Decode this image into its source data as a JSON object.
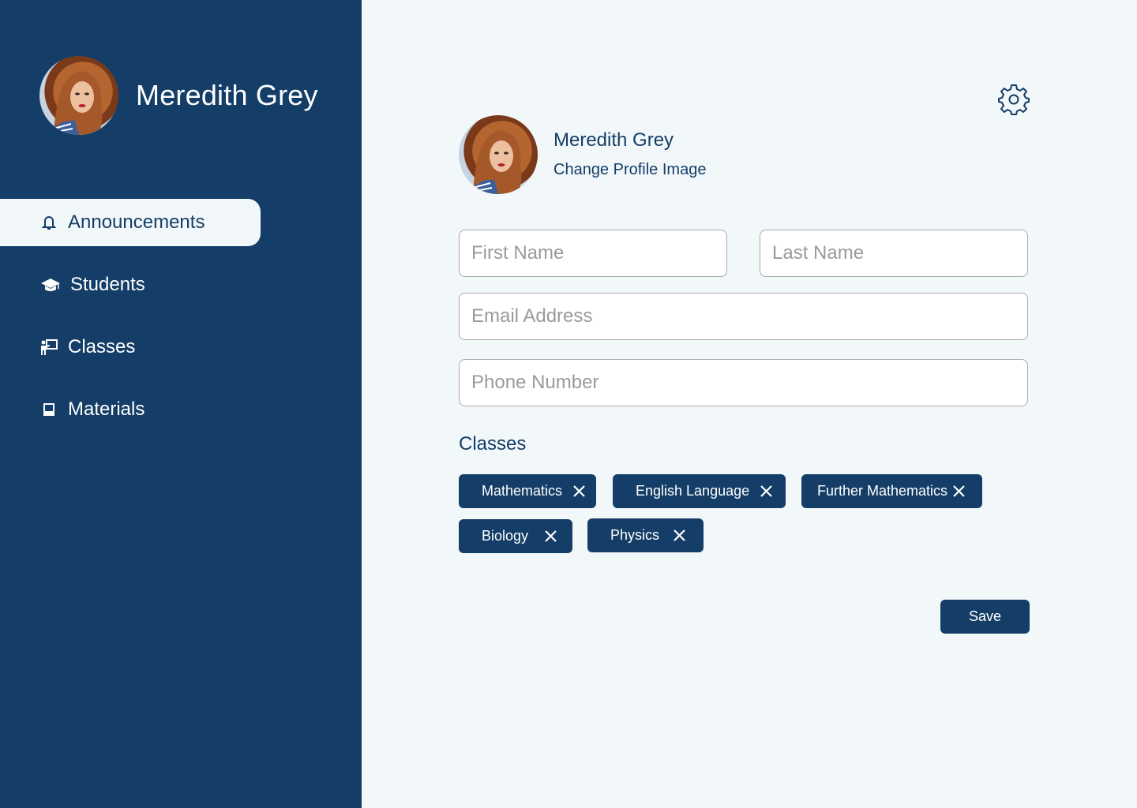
{
  "sidebar": {
    "user_name": "Meredith Grey",
    "nav": [
      {
        "label": "Announcements",
        "icon": "bell-icon",
        "active": true
      },
      {
        "label": "Students",
        "icon": "graduation-cap-icon",
        "active": false
      },
      {
        "label": "Classes",
        "icon": "teacher-board-icon",
        "active": false
      },
      {
        "label": "Materials",
        "icon": "book-icon",
        "active": false
      }
    ]
  },
  "profile": {
    "name": "Meredith Grey",
    "change_image_label": "Change Profile Image",
    "settings_icon": "gear-icon"
  },
  "form": {
    "first_name_placeholder": "First Name",
    "last_name_placeholder": "Last Name",
    "email_placeholder": "Email Address",
    "phone_placeholder": "Phone Number"
  },
  "classes": {
    "title": "Classes",
    "items": [
      "Mathematics",
      "English Language",
      "Further Mathematics",
      "Biology",
      "Physics"
    ]
  },
  "actions": {
    "save_label": "Save"
  },
  "colors": {
    "primary": "#143e67",
    "background": "#f2f7fa",
    "field_border": "#a9a9a9"
  }
}
